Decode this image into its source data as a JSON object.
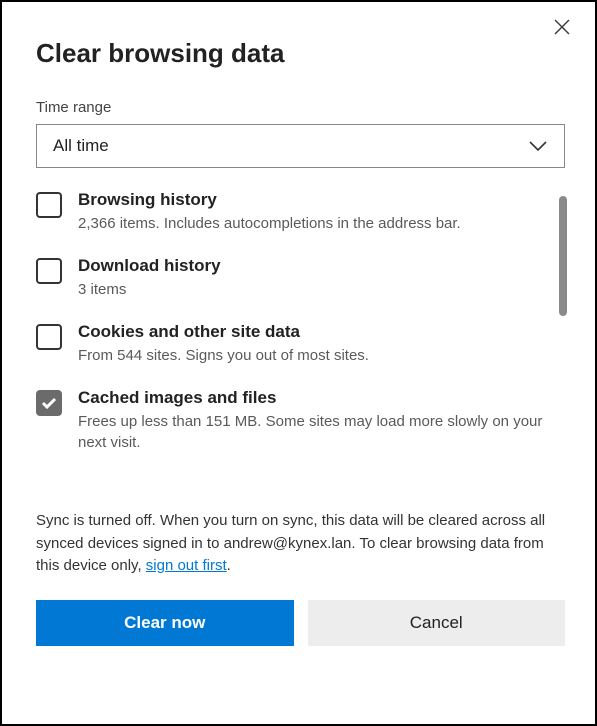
{
  "title": "Clear browsing data",
  "timeRange": {
    "label": "Time range",
    "selected": "All time"
  },
  "options": [
    {
      "title": "Browsing history",
      "desc": "2,366 items. Includes autocompletions in the address bar.",
      "checked": false
    },
    {
      "title": "Download history",
      "desc": "3 items",
      "checked": false
    },
    {
      "title": "Cookies and other site data",
      "desc": "From 544 sites. Signs you out of most sites.",
      "checked": false
    },
    {
      "title": "Cached images and files",
      "desc": "Frees up less than 151 MB. Some sites may load more slowly on your next visit.",
      "checked": true
    }
  ],
  "syncNote": {
    "before": "Sync is turned off. When you turn on sync, this data will be cleared across all synced devices signed in to andrew@kynex.lan. To clear browsing data from this device only, ",
    "link": "sign out first",
    "after": "."
  },
  "buttons": {
    "primary": "Clear now",
    "secondary": "Cancel"
  }
}
